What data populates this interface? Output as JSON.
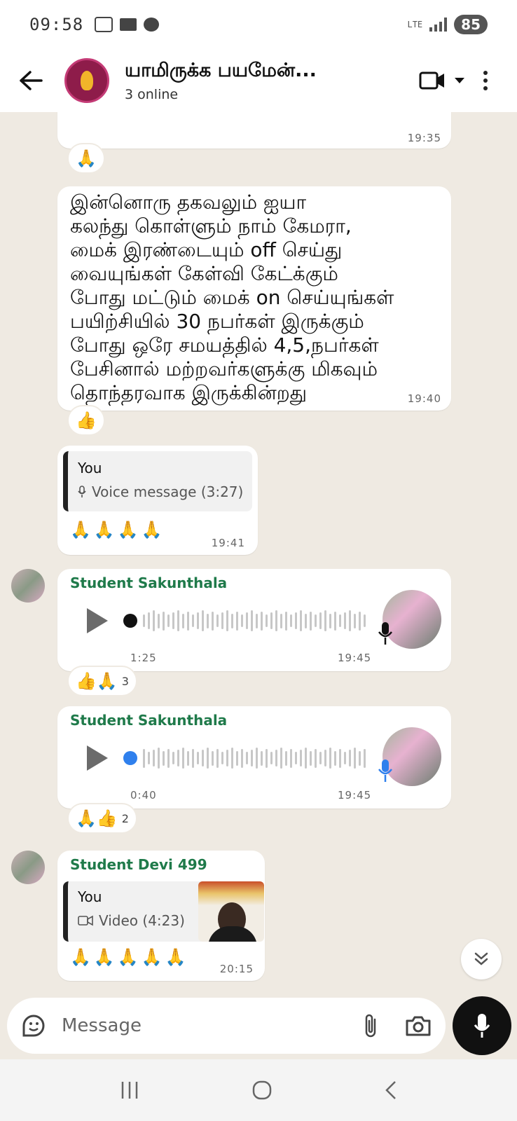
{
  "status_bar": {
    "time": "09:58",
    "network": "LTE",
    "battery": "85"
  },
  "header": {
    "title": "யாமிருக்க பயமேன்...",
    "subtitle": "3 online"
  },
  "messages": [
    {
      "id": "m1",
      "time": "19:35",
      "reaction": "🙏"
    },
    {
      "id": "m2",
      "lines": [
        "இன்னொரு தகவலும் ஐயா",
        "கலந்து கொள்ளும் நாம் கேமரா,",
        "மைக்  இரண்டையும் off செய்து",
        "வையுங்கள் கேள்வி கேட்க்கும்",
        "போது மட்டும் மைக் on செய்யுங்கள்",
        "பயிற்சியில் 30 நபர்கள் இருக்கும்",
        "போது ஒரே சமயத்தில் 4,5,நபர்கள்",
        "பேசினால்  மற்றவர்களுக்கு மிகவும்",
        "தொந்தரவாக இருக்கின்றது"
      ],
      "time": "19:40",
      "reaction": "👍"
    },
    {
      "id": "m3",
      "quote_author": "You",
      "quote_meta": "Voice message (3:27)",
      "body": "🙏🙏🙏🙏",
      "time": "19:41"
    },
    {
      "id": "m4",
      "sender": "Student Sakunthala",
      "duration": "1:25",
      "time": "19:45",
      "reaction": "👍🙏",
      "reaction_count": "3"
    },
    {
      "id": "m5",
      "sender": "Student Sakunthala",
      "duration": "0:40",
      "time": "19:45",
      "reaction": "🙏👍",
      "reaction_count": "2"
    },
    {
      "id": "m6",
      "sender": "Student Devi 499",
      "quote_author": "You",
      "quote_meta": "Video (4:23)",
      "body": "🙏🙏🙏🙏🙏",
      "time": "20:15"
    }
  ],
  "composer": {
    "placeholder": "Message"
  },
  "colors": {
    "chat_background": "#efeae2",
    "bubble": "#ffffff",
    "sender_name": "#1f7a4a",
    "played_dot": "#111111",
    "unplayed_dot": "#2f80ed"
  },
  "icons": [
    "back-arrow-icon",
    "video-call-icon",
    "chevron-down-icon",
    "more-vert-icon",
    "play-icon",
    "mic-icon",
    "video-icon",
    "sticker-icon",
    "attach-icon",
    "camera-icon",
    "scroll-down-icon",
    "recents-icon",
    "home-icon",
    "back-nav-icon"
  ]
}
